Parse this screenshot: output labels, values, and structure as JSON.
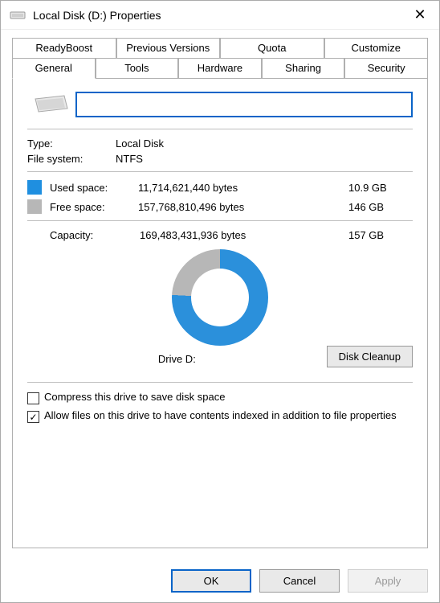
{
  "window": {
    "title": "Local Disk (D:) Properties"
  },
  "tabs_row1": [
    "ReadyBoost",
    "Previous Versions",
    "Quota",
    "Customize"
  ],
  "tabs_row2": [
    "General",
    "Tools",
    "Hardware",
    "Sharing",
    "Security"
  ],
  "active_tab": "General",
  "general": {
    "label_value": "",
    "type_label": "Type:",
    "type_value": "Local Disk",
    "fs_label": "File system:",
    "fs_value": "NTFS",
    "used_label": "Used space:",
    "used_bytes": "11,714,621,440 bytes",
    "used_gb": "10.9 GB",
    "free_label": "Free space:",
    "free_bytes": "157,768,810,496 bytes",
    "free_gb": "146 GB",
    "cap_label": "Capacity:",
    "cap_bytes": "169,483,431,936 bytes",
    "cap_gb": "157 GB",
    "drive_caption": "Drive D:",
    "cleanup_btn": "Disk Cleanup",
    "compress_label": "Compress this drive to save disk space",
    "index_label": "Allow files on this drive to have contents indexed in addition to file properties",
    "compress_checked": false,
    "index_checked": true
  },
  "buttons": {
    "ok": "OK",
    "cancel": "Cancel",
    "apply": "Apply"
  },
  "chart_data": {
    "type": "pie",
    "title": "Drive D:",
    "series": [
      {
        "name": "Used space",
        "value_bytes": 11714621440,
        "value_label": "10.9 GB",
        "color": "#1f8fe0"
      },
      {
        "name": "Free space",
        "value_bytes": 157768810496,
        "value_label": "146 GB",
        "color": "#b7b7b7"
      }
    ],
    "total": {
      "label": "Capacity",
      "value_bytes": 169483431936,
      "value_label": "157 GB"
    }
  }
}
